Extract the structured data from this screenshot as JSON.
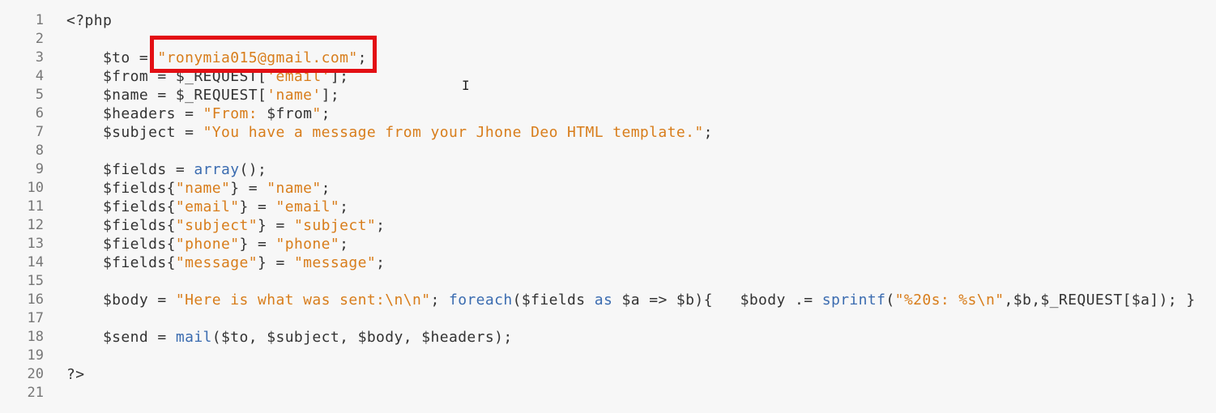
{
  "editor": {
    "language": "php",
    "highlight": {
      "line": 3,
      "text": "\"ronymia015@gmail.com\";",
      "color": "#e30f14"
    },
    "cursor_icon": "text-cursor-icon",
    "colors": {
      "background": "#f7f7f7",
      "plain": "#333333",
      "string": "#d87d1b",
      "function": "#3b6cb0",
      "gutter": "#777777"
    },
    "lines": [
      {
        "number": "1",
        "tokens": [
          {
            "t": "plain",
            "v": "<?php"
          }
        ]
      },
      {
        "number": "2",
        "tokens": []
      },
      {
        "number": "3",
        "tokens": [
          {
            "t": "plain",
            "v": "    $to = "
          },
          {
            "t": "str",
            "v": "\"ronymia015@gmail.com\""
          },
          {
            "t": "plain",
            "v": ";"
          }
        ]
      },
      {
        "number": "4",
        "tokens": [
          {
            "t": "plain",
            "v": "    $from = $_REQUEST["
          },
          {
            "t": "str",
            "v": "'email'"
          },
          {
            "t": "plain",
            "v": "];"
          }
        ]
      },
      {
        "number": "5",
        "tokens": [
          {
            "t": "plain",
            "v": "    $name = $_REQUEST["
          },
          {
            "t": "str",
            "v": "'name'"
          },
          {
            "t": "plain",
            "v": "];"
          }
        ]
      },
      {
        "number": "6",
        "tokens": [
          {
            "t": "plain",
            "v": "    $headers = "
          },
          {
            "t": "str",
            "v": "\"From: "
          },
          {
            "t": "plain",
            "v": "$from"
          },
          {
            "t": "str",
            "v": "\""
          },
          {
            "t": "plain",
            "v": ";"
          }
        ]
      },
      {
        "number": "7",
        "tokens": [
          {
            "t": "plain",
            "v": "    $subject = "
          },
          {
            "t": "str",
            "v": "\"You have a message from your Jhone Deo HTML template.\""
          },
          {
            "t": "plain",
            "v": ";"
          }
        ]
      },
      {
        "number": "8",
        "tokens": []
      },
      {
        "number": "9",
        "tokens": [
          {
            "t": "plain",
            "v": "    $fields = "
          },
          {
            "t": "fn",
            "v": "array"
          },
          {
            "t": "plain",
            "v": "();"
          }
        ]
      },
      {
        "number": "10",
        "tokens": [
          {
            "t": "plain",
            "v": "    $fields{"
          },
          {
            "t": "str",
            "v": "\"name\""
          },
          {
            "t": "plain",
            "v": "} = "
          },
          {
            "t": "str",
            "v": "\"name\""
          },
          {
            "t": "plain",
            "v": ";"
          }
        ]
      },
      {
        "number": "11",
        "tokens": [
          {
            "t": "plain",
            "v": "    $fields{"
          },
          {
            "t": "str",
            "v": "\"email\""
          },
          {
            "t": "plain",
            "v": "} = "
          },
          {
            "t": "str",
            "v": "\"email\""
          },
          {
            "t": "plain",
            "v": ";"
          }
        ]
      },
      {
        "number": "12",
        "tokens": [
          {
            "t": "plain",
            "v": "    $fields{"
          },
          {
            "t": "str",
            "v": "\"subject\""
          },
          {
            "t": "plain",
            "v": "} = "
          },
          {
            "t": "str",
            "v": "\"subject\""
          },
          {
            "t": "plain",
            "v": ";"
          }
        ]
      },
      {
        "number": "13",
        "tokens": [
          {
            "t": "plain",
            "v": "    $fields{"
          },
          {
            "t": "str",
            "v": "\"phone\""
          },
          {
            "t": "plain",
            "v": "} = "
          },
          {
            "t": "str",
            "v": "\"phone\""
          },
          {
            "t": "plain",
            "v": ";"
          }
        ]
      },
      {
        "number": "14",
        "tokens": [
          {
            "t": "plain",
            "v": "    $fields{"
          },
          {
            "t": "str",
            "v": "\"message\""
          },
          {
            "t": "plain",
            "v": "} = "
          },
          {
            "t": "str",
            "v": "\"message\""
          },
          {
            "t": "plain",
            "v": ";"
          }
        ]
      },
      {
        "number": "15",
        "tokens": []
      },
      {
        "number": "16",
        "tokens": [
          {
            "t": "plain",
            "v": "    $body = "
          },
          {
            "t": "str",
            "v": "\"Here is what was sent:\\n\\n\""
          },
          {
            "t": "plain",
            "v": "; "
          },
          {
            "t": "kw",
            "v": "foreach"
          },
          {
            "t": "plain",
            "v": "($fields "
          },
          {
            "t": "kw",
            "v": "as"
          },
          {
            "t": "plain",
            "v": " $a => $b){   $body .= "
          },
          {
            "t": "fn",
            "v": "sprintf"
          },
          {
            "t": "plain",
            "v": "("
          },
          {
            "t": "str",
            "v": "\"%20s: %s\\n\""
          },
          {
            "t": "plain",
            "v": ",$b,$_REQUEST[$a]); }"
          }
        ]
      },
      {
        "number": "17",
        "tokens": []
      },
      {
        "number": "18",
        "tokens": [
          {
            "t": "plain",
            "v": "    $send = "
          },
          {
            "t": "fn",
            "v": "mail"
          },
          {
            "t": "plain",
            "v": "($to, $subject, $body, $headers);"
          }
        ]
      },
      {
        "number": "19",
        "tokens": []
      },
      {
        "number": "20",
        "tokens": [
          {
            "t": "plain",
            "v": "?>"
          }
        ]
      },
      {
        "number": "21",
        "tokens": []
      }
    ]
  }
}
